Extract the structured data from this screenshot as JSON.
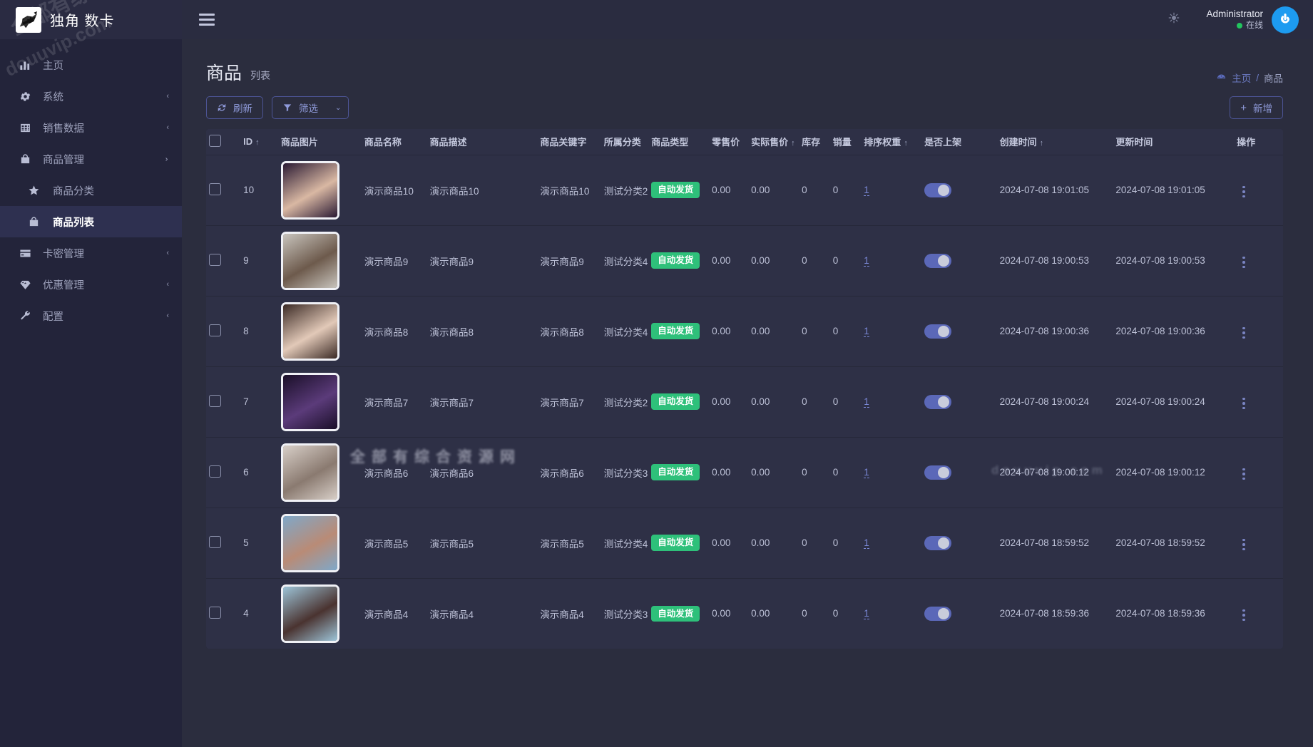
{
  "brand": {
    "title": "独角 数卡",
    "logo_icon": "unicorn-logo-icon"
  },
  "sidebar": {
    "watermark_line1": "全部有综合资源网",
    "watermark_line2": "douuvip.com",
    "items": [
      {
        "label": "主页",
        "icon": "chart-bar-icon",
        "caret": "",
        "active": false,
        "sub": false
      },
      {
        "label": "系统",
        "icon": "gear-icon",
        "caret": "‹",
        "active": false,
        "sub": false
      },
      {
        "label": "销售数据",
        "icon": "table-grid-icon",
        "caret": "‹",
        "active": false,
        "sub": false
      },
      {
        "label": "商品管理",
        "icon": "bag-icon",
        "caret": "⌄",
        "active": false,
        "sub": false
      },
      {
        "label": "商品分类",
        "icon": "star-icon",
        "caret": "",
        "active": false,
        "sub": true
      },
      {
        "label": "商品列表",
        "icon": "bag-icon",
        "caret": "",
        "active": true,
        "sub": true
      },
      {
        "label": "卡密管理",
        "icon": "card-icon",
        "caret": "‹",
        "active": false,
        "sub": false
      },
      {
        "label": "优惠管理",
        "icon": "diamond-icon",
        "caret": "‹",
        "active": false,
        "sub": false
      },
      {
        "label": "配置",
        "icon": "wrench-icon",
        "caret": "‹",
        "active": false,
        "sub": false
      }
    ]
  },
  "topbar": {
    "menu_icon": "hamburger-icon",
    "weather_icon": "weather-sun-icon",
    "user_name": "Administrator",
    "user_status": "在线",
    "avatar_icon": "power-avatar-icon"
  },
  "page": {
    "title": "商品",
    "subtitle": "列表",
    "breadcrumb": {
      "home_icon": "dashboard-icon",
      "home": "主页",
      "separator": "/",
      "current": "商品"
    }
  },
  "toolbar": {
    "refresh_label": "刷新",
    "refresh_icon": "refresh-icon",
    "filter_label": "筛选",
    "filter_icon": "funnel-icon",
    "filter_caret": "⌄",
    "add_label": "新增",
    "add_icon": "plus-icon"
  },
  "table": {
    "columns": [
      {
        "key": "checkbox",
        "label": "",
        "sort": ""
      },
      {
        "key": "id",
        "label": "ID",
        "sort": "↑"
      },
      {
        "key": "image",
        "label": "商品图片",
        "sort": ""
      },
      {
        "key": "name",
        "label": "商品名称",
        "sort": ""
      },
      {
        "key": "desc",
        "label": "商品描述",
        "sort": ""
      },
      {
        "key": "keyword",
        "label": "商品关键字",
        "sort": ""
      },
      {
        "key": "category",
        "label": "所属分类",
        "sort": ""
      },
      {
        "key": "type",
        "label": "商品类型",
        "sort": ""
      },
      {
        "key": "price",
        "label": "零售价",
        "sort": ""
      },
      {
        "key": "actual",
        "label": "实际售价",
        "sort": "↑"
      },
      {
        "key": "stock",
        "label": "库存",
        "sort": ""
      },
      {
        "key": "sales",
        "label": "销量",
        "sort": ""
      },
      {
        "key": "weight",
        "label": "排序权重",
        "sort": "↑"
      },
      {
        "key": "online",
        "label": "是否上架",
        "sort": ""
      },
      {
        "key": "created",
        "label": "创建时间",
        "sort": "↑"
      },
      {
        "key": "updated",
        "label": "更新时间",
        "sort": ""
      },
      {
        "key": "actions",
        "label": "操作",
        "sort": ""
      }
    ],
    "rows": [
      {
        "id": "10",
        "name": "演示商品10",
        "desc": "演示商品10",
        "keyword": "演示商品10",
        "category": "测试分类2",
        "type": "自动发货",
        "price": "0.00",
        "actual": "0.00",
        "stock": "0",
        "sales": "0",
        "weight": "1",
        "online": true,
        "created": "2024-07-08 19:01:05",
        "updated": "2024-07-08 19:01:05",
        "img_a": "#2a1a33",
        "img_b": "#d9b8a3",
        "blurred": false
      },
      {
        "id": "9",
        "name": "演示商品9",
        "desc": "演示商品9",
        "keyword": "演示商品9",
        "category": "测试分类4",
        "type": "自动发货",
        "price": "0.00",
        "actual": "0.00",
        "stock": "0",
        "sales": "0",
        "weight": "1",
        "online": true,
        "created": "2024-07-08 19:00:53",
        "updated": "2024-07-08 19:00:53",
        "img_a": "#c8c4bd",
        "img_b": "#6d5a4c",
        "blurred": false
      },
      {
        "id": "8",
        "name": "演示商品8",
        "desc": "演示商品8",
        "keyword": "演示商品8",
        "category": "测试分类4",
        "type": "自动发货",
        "price": "0.00",
        "actual": "0.00",
        "stock": "0",
        "sales": "0",
        "weight": "1",
        "online": true,
        "created": "2024-07-08 19:00:36",
        "updated": "2024-07-08 19:00:36",
        "img_a": "#3b2a25",
        "img_b": "#e2c9b8",
        "blurred": false
      },
      {
        "id": "7",
        "name": "演示商品7",
        "desc": "演示商品7",
        "keyword": "演示商品7",
        "category": "测试分类2",
        "type": "自动发货",
        "price": "0.00",
        "actual": "0.00",
        "stock": "0",
        "sales": "0",
        "weight": "1",
        "online": true,
        "created": "2024-07-08 19:00:24",
        "updated": "2024-07-08 19:00:24",
        "img_a": "#1a0f28",
        "img_b": "#5b3b7a",
        "blurred": false
      },
      {
        "id": "6",
        "name": "演示商品6",
        "desc": "演示商品6",
        "keyword": "演示商品6",
        "category": "测试分类3",
        "type": "自动发货",
        "price": "0.00",
        "actual": "0.00",
        "stock": "0",
        "sales": "0",
        "weight": "1",
        "online": true,
        "created": "2024-07-08 19:00:12",
        "updated": "2024-07-08 19:00:12",
        "img_a": "#d8cfc8",
        "img_b": "#8a7a70",
        "blurred": true
      },
      {
        "id": "5",
        "name": "演示商品5",
        "desc": "演示商品5",
        "keyword": "演示商品5",
        "category": "测试分类4",
        "type": "自动发货",
        "price": "0.00",
        "actual": "0.00",
        "stock": "0",
        "sales": "0",
        "weight": "1",
        "online": true,
        "created": "2024-07-08 18:59:52",
        "updated": "2024-07-08 18:59:52",
        "img_a": "#7fa8c9",
        "img_b": "#b98b76",
        "blurred": false
      },
      {
        "id": "4",
        "name": "演示商品4",
        "desc": "演示商品4",
        "keyword": "演示商品4",
        "category": "测试分类3",
        "type": "自动发货",
        "price": "0.00",
        "actual": "0.00",
        "stock": "0",
        "sales": "0",
        "weight": "1",
        "online": true,
        "created": "2024-07-08 18:59:36",
        "updated": "2024-07-08 18:59:36",
        "img_a": "#9dc4d8",
        "img_b": "#4a3330",
        "blurred": false
      }
    ]
  },
  "colors": {
    "sidebar_bg": "#23243a",
    "panel_bg": "#2e3046",
    "page_bg": "#2b2d3e",
    "accent": "#6d7cc6",
    "badge_green": "#2ec07a",
    "switch_on": "#5b68b8",
    "online_green": "#22c55e"
  }
}
